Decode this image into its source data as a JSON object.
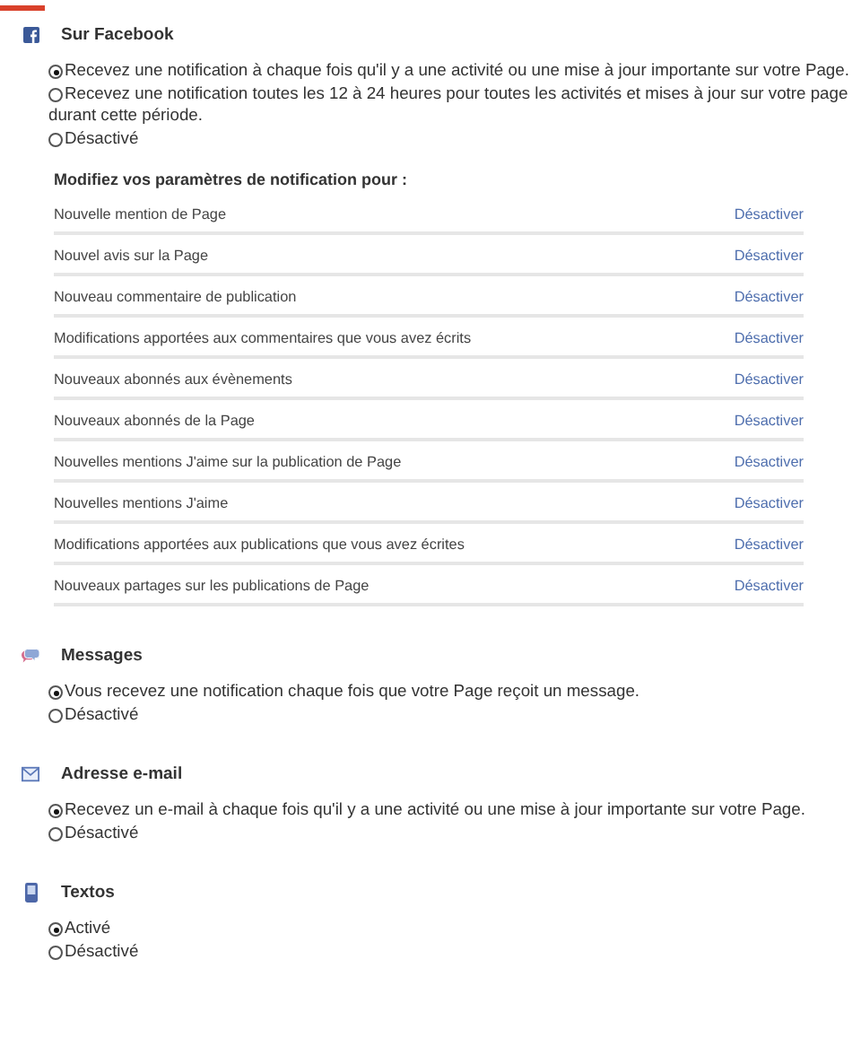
{
  "sections": [
    {
      "kind": "facebook",
      "title": "Sur Facebook",
      "options": [
        {
          "label": "Recevez une notification à chaque fois qu'il y a une activité ou une mise à jour importante sur votre Page.",
          "selected": true
        },
        {
          "label": "Recevez une notification toutes les 12 à 24 heures pour toutes les activités et mises à jour sur votre page durant cette période.",
          "selected": false
        },
        {
          "label": "Désactivé",
          "selected": false
        }
      ],
      "settings": {
        "heading": "Modifiez vos paramètres de notification pour :",
        "rows": [
          {
            "label": "Nouvelle mention de Page",
            "action": "Désactiver"
          },
          {
            "label": "Nouvel avis sur la Page",
            "action": "Désactiver"
          },
          {
            "label": "Nouveau commentaire de publication",
            "action": "Désactiver"
          },
          {
            "label": "Modifications apportées aux commentaires que vous avez écrits",
            "action": "Désactiver"
          },
          {
            "label": "Nouveaux abonnés aux évènements",
            "action": "Désactiver"
          },
          {
            "label": "Nouveaux abonnés de la Page",
            "action": "Désactiver"
          },
          {
            "label": "Nouvelles mentions J'aime sur la publication de Page",
            "action": "Désactiver"
          },
          {
            "label": "Nouvelles mentions J'aime",
            "action": "Désactiver"
          },
          {
            "label": "Modifications apportées aux publications que vous avez écrites",
            "action": "Désactiver"
          },
          {
            "label": "Nouveaux partages sur les publications de Page",
            "action": "Désactiver"
          }
        ]
      }
    },
    {
      "kind": "messages",
      "title": "Messages",
      "options": [
        {
          "label": "Vous recevez une notification chaque fois que votre Page reçoit un message.",
          "selected": true
        },
        {
          "label": "Désactivé",
          "selected": false
        }
      ]
    },
    {
      "kind": "email",
      "title": "Adresse e-mail",
      "options": [
        {
          "label": "Recevez un e-mail à chaque fois qu'il y a une activité ou une mise à jour importante sur votre Page.",
          "selected": true
        },
        {
          "label": "Désactivé",
          "selected": false
        }
      ]
    },
    {
      "kind": "sms",
      "title": "Textos",
      "options": [
        {
          "label": "Activé",
          "selected": true
        },
        {
          "label": "Désactivé",
          "selected": false
        }
      ]
    }
  ]
}
